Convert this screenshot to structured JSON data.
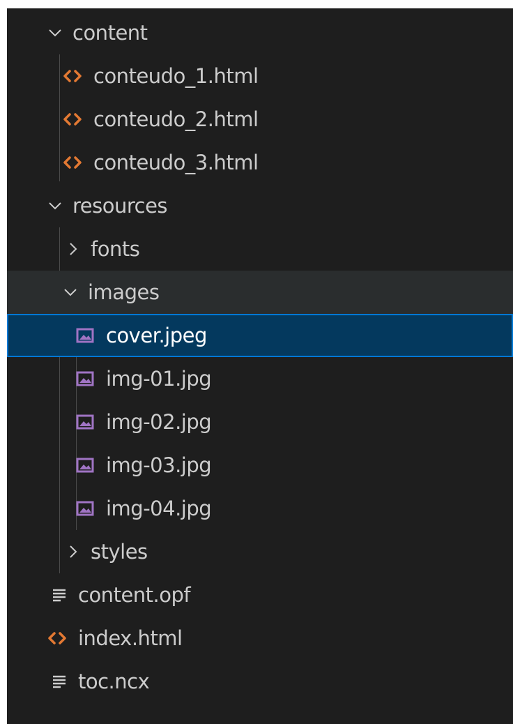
{
  "explorer": {
    "items": [
      {
        "label": "content",
        "type": "folder",
        "state": "expanded",
        "icon": "chevron-down-icon"
      },
      {
        "label": "conteudo_1.html",
        "type": "file",
        "icon": "html-file-icon"
      },
      {
        "label": "conteudo_2.html",
        "type": "file",
        "icon": "html-file-icon"
      },
      {
        "label": "conteudo_3.html",
        "type": "file",
        "icon": "html-file-icon"
      },
      {
        "label": "resources",
        "type": "folder",
        "state": "expanded",
        "icon": "chevron-down-icon"
      },
      {
        "label": "fonts",
        "type": "folder",
        "state": "collapsed",
        "icon": "chevron-right-icon"
      },
      {
        "label": "images",
        "type": "folder",
        "state": "expanded",
        "icon": "chevron-down-icon"
      },
      {
        "label": "cover.jpeg",
        "type": "file",
        "icon": "image-file-icon",
        "selected": true
      },
      {
        "label": "img-01.jpg",
        "type": "file",
        "icon": "image-file-icon"
      },
      {
        "label": "img-02.jpg",
        "type": "file",
        "icon": "image-file-icon"
      },
      {
        "label": "img-03.jpg",
        "type": "file",
        "icon": "image-file-icon"
      },
      {
        "label": "img-04.jpg",
        "type": "file",
        "icon": "image-file-icon"
      },
      {
        "label": "styles",
        "type": "folder",
        "state": "collapsed",
        "icon": "chevron-right-icon"
      },
      {
        "label": "content.opf",
        "type": "file",
        "icon": "text-file-icon"
      },
      {
        "label": "index.html",
        "type": "file",
        "icon": "html-file-icon"
      },
      {
        "label": "toc.ncx",
        "type": "file",
        "icon": "text-file-icon"
      }
    ]
  },
  "colors": {
    "background": "#1e1e1e",
    "text": "#cccccc",
    "selected_background": "#04395e",
    "selected_border": "#0078d4",
    "hover_background": "#2a2d2e",
    "html_icon": "#e37933",
    "image_icon": "#a074c4",
    "indent_guide": "#4b4b4b"
  }
}
